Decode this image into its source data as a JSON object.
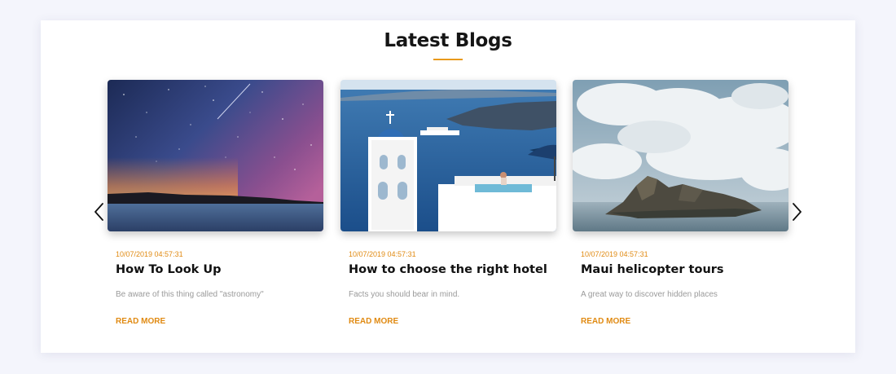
{
  "section": {
    "title": "Latest Blogs"
  },
  "posts": [
    {
      "date": "10/07/2019 04:57:31",
      "title": "How To Look Up",
      "description": "Be aware of this thing called \"astronomy\"",
      "link_label": "READ MORE"
    },
    {
      "date": "10/07/2019 04:57:31",
      "title": "How to choose the right hotel",
      "description": "Facts you should bear in mind.",
      "link_label": "READ MORE"
    },
    {
      "date": "10/07/2019 04:57:31",
      "title": "Maui helicopter tours",
      "description": "A great way to discover hidden places",
      "link_label": "READ MORE"
    }
  ],
  "colors": {
    "accent": "#e08a12",
    "title": "#111111",
    "muted": "#9a9a9a",
    "page_background": "#f4f5fc"
  },
  "icons": {
    "prev": "chevron-left-icon",
    "next": "chevron-right-icon"
  }
}
